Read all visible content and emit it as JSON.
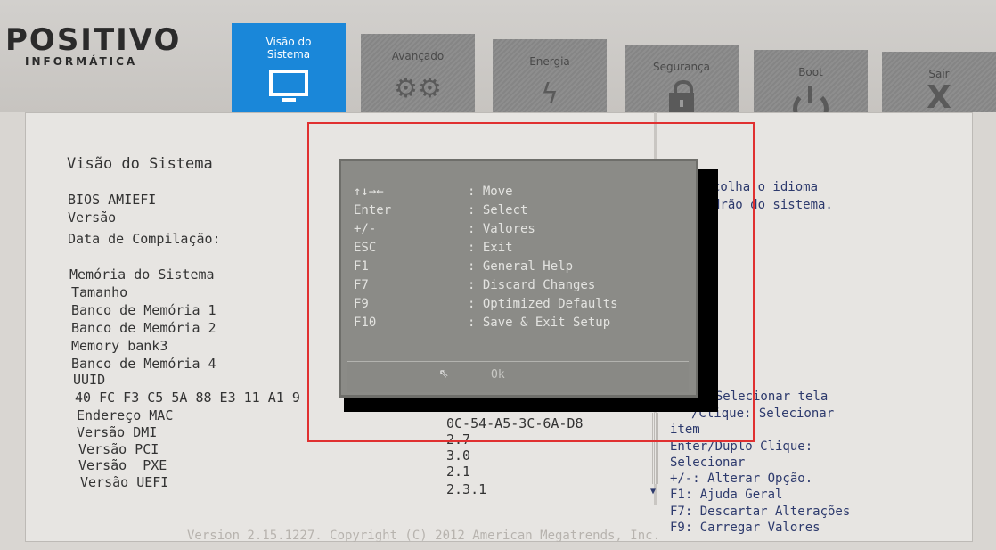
{
  "brand": {
    "name": "POSITIVO",
    "sub": "INFORMÁTICA"
  },
  "tabs": [
    {
      "label": "Visão do\nSistema",
      "icon": "monitor-icon",
      "active": true
    },
    {
      "label": "Avançado",
      "icon": "gears-icon"
    },
    {
      "label": "Energia",
      "icon": "lightning-icon"
    },
    {
      "label": "Segurança",
      "icon": "lock-icon"
    },
    {
      "label": "Boot",
      "icon": "power-icon"
    },
    {
      "label": "Sair",
      "icon": "x-icon"
    }
  ],
  "main": {
    "title": "Visão do Sistema",
    "bios": "BIOS AMIEFI",
    "version_label": "Versão",
    "build_date_label": "Data de Compilação:",
    "memory_title": "Memória do Sistema",
    "size_label": "Tamanho",
    "bank1": "Banco de Memória 1",
    "bank2": "Banco de Memória 2",
    "bank3": "Memory bank3",
    "bank4": "Banco de Memória 4",
    "uuid_label": "UUID",
    "uuid_value": "40 FC F3 C5 5A 88 E3 11 A1 9",
    "mac_label": "Endereço MAC",
    "mac_value": "0C-54-A5-3C-6A-D8",
    "dmi_label": "Versão DMI",
    "dmi_value": "2.7",
    "pci_label": "Versão PCI",
    "pci_value": "3.0",
    "pxe_label": "Versão  PXE",
    "pxe_value": "2.1",
    "uefi_label": "Versão UEFI",
    "uefi_value": "2.3.1"
  },
  "help": {
    "desc_line1": "colha o idioma",
    "desc_line2": "drão do sistema.",
    "line1": ": Selecionar tela",
    "line2": "/Clique: Selecionar",
    "line3": "item",
    "line4": "Enter/Duplo Clique:",
    "line5": "Selecionar",
    "line6": "+/-: Alterar Opção.",
    "line7": "F1: Ajuda Geral",
    "line8": "F7: Descartar Alterações",
    "line9": "F9: Carregar Valores"
  },
  "dialog": {
    "rows": [
      {
        "key": "↑↓→←",
        "desc": ": Move"
      },
      {
        "key": "Enter",
        "desc": ": Select"
      },
      {
        "key": "+/-",
        "desc": ": Valores"
      },
      {
        "key": "ESC",
        "desc": ": Exit"
      },
      {
        "key": "F1",
        "desc": ": General Help"
      },
      {
        "key": "F7",
        "desc": ": Discard Changes"
      },
      {
        "key": "F9",
        "desc": ": Optimized Defaults"
      },
      {
        "key": "F10",
        "desc": ": Save & Exit Setup"
      }
    ],
    "ok": "Ok"
  },
  "footer": "Version 2.15.1227. Copyright (C) 2012 American Megatrends, Inc."
}
